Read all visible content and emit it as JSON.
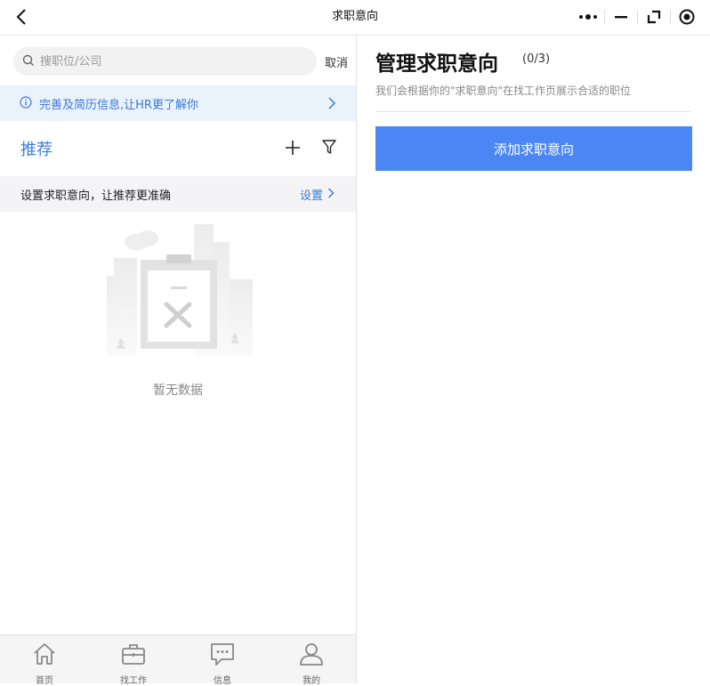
{
  "navbar": {
    "title": "求职意向"
  },
  "search": {
    "placeholder": "搜职位/公司",
    "cancel_label": "取消"
  },
  "notice": {
    "text": "完善及简历信息,让HR更了解你"
  },
  "recommend": {
    "title": "推荐"
  },
  "tip": {
    "text": "设置求职意向，让推荐更准确",
    "action_label": "设置"
  },
  "empty": {
    "text": "暂无数据"
  },
  "tabbar": {
    "items": [
      {
        "label": "首页",
        "icon": "home-icon"
      },
      {
        "label": "找工作",
        "icon": "briefcase-icon"
      },
      {
        "label": "信息",
        "icon": "message-icon"
      },
      {
        "label": "我的",
        "icon": "user-icon"
      }
    ]
  },
  "manage": {
    "title": "管理求职意向",
    "count": "(0/3)",
    "description": "我们会根据你的\"求职意向\"在找工作页展示合适的职位",
    "add_button_label": "添加求职意向"
  },
  "colors": {
    "accent": "#4a87f5",
    "link": "#3a78d8",
    "notice_bg": "#eaf3fc"
  }
}
